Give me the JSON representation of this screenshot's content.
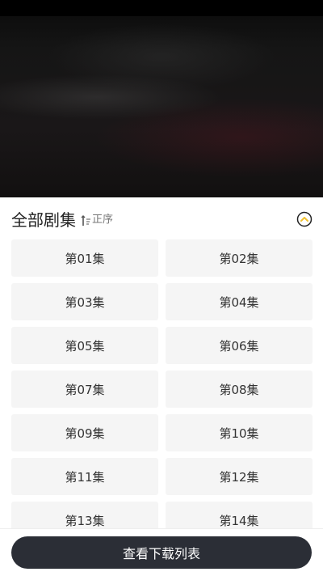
{
  "player": {
    "background_color": "#141414"
  },
  "episodes_panel": {
    "title": "全部剧集",
    "sort_label": "正序",
    "sort_icon": "sort-order-icon",
    "collapse_icon": "chevron-up-circle-icon",
    "accent_color": "#f2c230",
    "episodes": [
      "第01集",
      "第02集",
      "第03集",
      "第04集",
      "第05集",
      "第06集",
      "第07集",
      "第08集",
      "第09集",
      "第10集",
      "第11集",
      "第12集",
      "第13集",
      "第14集"
    ]
  },
  "footer": {
    "download_list_label": "查看下载列表"
  }
}
